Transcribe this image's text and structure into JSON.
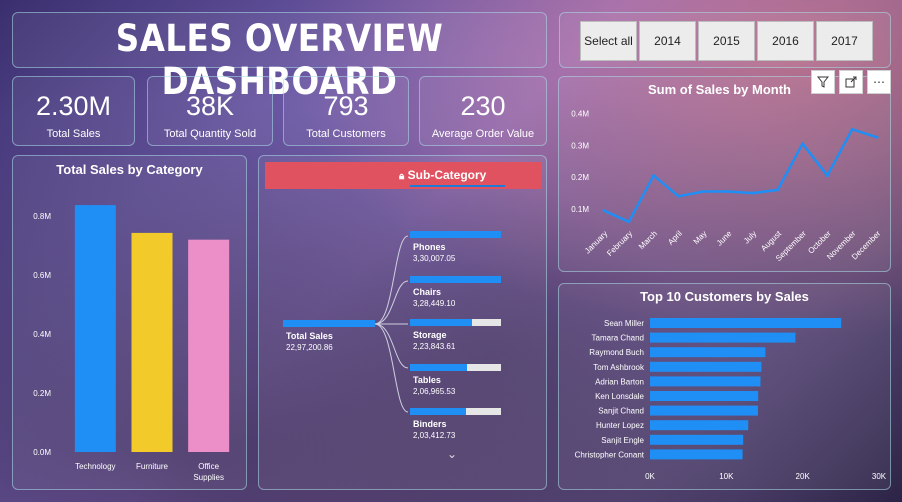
{
  "title": "SALES OVERVIEW DASHBOARD",
  "slicer": {
    "options": [
      "Select all",
      "2014",
      "2015",
      "2016",
      "2017"
    ]
  },
  "kpis": [
    {
      "value": "2.30M",
      "label": "Total Sales"
    },
    {
      "value": "38K",
      "label": "Total Quantity Sold"
    },
    {
      "value": "793",
      "label": "Total Customers"
    },
    {
      "value": "230",
      "label": "Average Order Value"
    }
  ],
  "category_chart": {
    "title": "Total Sales by Category",
    "y_ticks": [
      "0.0M",
      "0.2M",
      "0.4M",
      "0.6M",
      "0.8M"
    ],
    "bars": [
      {
        "label": "Technology",
        "color": "#1f8ef5"
      },
      {
        "label": "Furniture",
        "color": "#f2cb2b"
      },
      {
        "label": "Office Supplies",
        "color": "#ec8fc9"
      }
    ]
  },
  "subcategory": {
    "header": "Sub-Category",
    "root_label": "Total Sales",
    "root_value": "22,97,200.86",
    "nodes": [
      {
        "label": "Phones",
        "value": "3,30,007.05",
        "fraction": 1.0
      },
      {
        "label": "Chairs",
        "value": "3,28,449.10",
        "fraction": 0.995
      },
      {
        "label": "Storage",
        "value": "2,23,843.61",
        "fraction": 0.68
      },
      {
        "label": "Tables",
        "value": "2,06,965.53",
        "fraction": 0.627
      },
      {
        "label": "Binders",
        "value": "2,03,412.73",
        "fraction": 0.616
      }
    ]
  },
  "month_chart": {
    "title": "Sum of Sales by Month",
    "y_ticks": [
      "0.1M",
      "0.2M",
      "0.3M",
      "0.4M"
    ],
    "toolbar_icons": [
      "filter-icon",
      "focus-mode-icon",
      "more-options-icon"
    ]
  },
  "customers_chart": {
    "title": "Top 10 Customers by Sales",
    "x_ticks": [
      "0K",
      "10K",
      "20K",
      "30K"
    ]
  },
  "chart_data": [
    {
      "type": "bar",
      "title": "Total Sales by Category",
      "categories": [
        "Technology",
        "Furniture",
        "Office Supplies"
      ],
      "values": [
        836154,
        741999,
        719047
      ],
      "ylim": [
        0,
        0.85
      ],
      "yunit": "M",
      "grid": false
    },
    {
      "type": "line",
      "title": "Sum of Sales by Month",
      "x": [
        "January",
        "February",
        "March",
        "April",
        "May",
        "June",
        "July",
        "August",
        "September",
        "October",
        "November",
        "December"
      ],
      "values": [
        0.095,
        0.06,
        0.205,
        0.14,
        0.155,
        0.155,
        0.15,
        0.16,
        0.305,
        0.205,
        0.35,
        0.325
      ],
      "ylim": [
        0.05,
        0.42
      ],
      "yunit": "M",
      "color": "#1f8ef5"
    },
    {
      "type": "bar",
      "orientation": "horizontal",
      "title": "Top 10 Customers by Sales",
      "categories": [
        "Sean Miller",
        "Tamara Chand",
        "Raymond Buch",
        "Tom Ashbrook",
        "Adrian Barton",
        "Ken Lonsdale",
        "Sanjit Chand",
        "Hunter Lopez",
        "Sanjit Engle",
        "Christopher Conant"
      ],
      "values": [
        25043,
        19052,
        15117,
        14596,
        14474,
        14175,
        14142,
        12873,
        12209,
        12129
      ],
      "xlim": [
        0,
        30000
      ],
      "color": "#1f8ef5"
    }
  ]
}
